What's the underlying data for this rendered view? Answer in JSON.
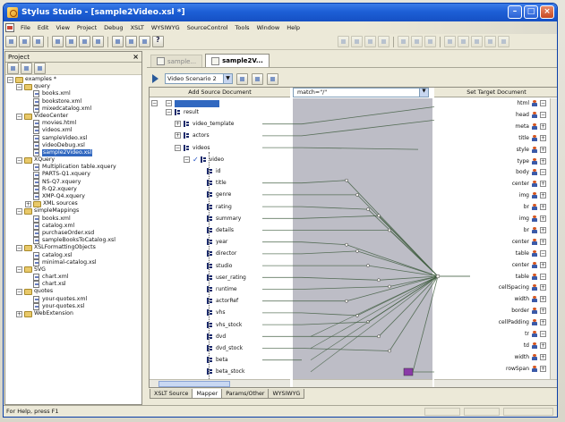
{
  "window": {
    "title": "Stylus Studio - [sample2Video.xsl *]"
  },
  "menu": {
    "items": [
      "File",
      "Edit",
      "View",
      "Project",
      "Debug",
      "XSLT",
      "WYSIWYG",
      "SourceControl",
      "Tools",
      "Window",
      "Help"
    ]
  },
  "project_panel": {
    "title": "Project",
    "tree": [
      {
        "label": "examples *",
        "kind": "folder",
        "depth": 0,
        "exp": "−"
      },
      {
        "label": "query",
        "kind": "folder",
        "depth": 1,
        "exp": "−"
      },
      {
        "label": "books.xml",
        "kind": "file",
        "depth": 2
      },
      {
        "label": "bookstore.xml",
        "kind": "file",
        "depth": 2
      },
      {
        "label": "mixedcatalog.xml",
        "kind": "file",
        "depth": 2
      },
      {
        "label": "VideoCenter",
        "kind": "folder",
        "depth": 1,
        "exp": "−"
      },
      {
        "label": "movies.html",
        "kind": "file",
        "depth": 2
      },
      {
        "label": "videos.xml",
        "kind": "file",
        "depth": 2
      },
      {
        "label": "sampleVideo.xsl",
        "kind": "file",
        "depth": 2
      },
      {
        "label": "videoDebug.xsl",
        "kind": "file",
        "depth": 2
      },
      {
        "label": "sample2Video.xsl",
        "kind": "file",
        "depth": 2,
        "selected": true
      },
      {
        "label": "XQuery",
        "kind": "folder",
        "depth": 1,
        "exp": "−"
      },
      {
        "label": "Multiplication table.xquery",
        "kind": "file",
        "depth": 2
      },
      {
        "label": "PARTS-Q1.xquery",
        "kind": "file",
        "depth": 2
      },
      {
        "label": "NS-Q7.xquery",
        "kind": "file",
        "depth": 2
      },
      {
        "label": "R-Q2.xquery",
        "kind": "file",
        "depth": 2
      },
      {
        "label": "XMP-Q4.xquery",
        "kind": "file",
        "depth": 2
      },
      {
        "label": "XML sources",
        "kind": "folder",
        "depth": 2,
        "exp": "+"
      },
      {
        "label": "simpleMappings",
        "kind": "folder",
        "depth": 1,
        "exp": "−"
      },
      {
        "label": "books.xml",
        "kind": "file",
        "depth": 2
      },
      {
        "label": "catalog.xml",
        "kind": "file",
        "depth": 2
      },
      {
        "label": "purchaseOrder.xsd",
        "kind": "file",
        "depth": 2
      },
      {
        "label": "sampleBooksToCatalog.xsl",
        "kind": "file",
        "depth": 2
      },
      {
        "label": "XSLFormattingObjects",
        "kind": "folder",
        "depth": 1,
        "exp": "−"
      },
      {
        "label": "catalog.xsl",
        "kind": "file",
        "depth": 2
      },
      {
        "label": "minimal-catalog.xsl",
        "kind": "file",
        "depth": 2
      },
      {
        "label": "SVG",
        "kind": "folder",
        "depth": 1,
        "exp": "−"
      },
      {
        "label": "chart.xml",
        "kind": "file",
        "depth": 2
      },
      {
        "label": "chart.xsl",
        "kind": "file",
        "depth": 2
      },
      {
        "label": "quotes",
        "kind": "folder",
        "depth": 1,
        "exp": "−"
      },
      {
        "label": "your-quotes.xml",
        "kind": "file",
        "depth": 2
      },
      {
        "label": "your-quotes.xsl",
        "kind": "file",
        "depth": 2
      },
      {
        "label": "WebExtension",
        "kind": "folder",
        "depth": 1,
        "exp": "+"
      }
    ]
  },
  "doc_tabs": {
    "inactive_label": "sample...",
    "active_label": "sample2V..."
  },
  "scenario": {
    "selected": "Video Scenario 2"
  },
  "mapper": {
    "source_header": "Add Source Document",
    "match_value": "match=\"/\"",
    "target_header": "Set Target Document",
    "source_nodes": [
      {
        "label": "result",
        "indent": 1,
        "exp": "−"
      },
      {
        "label": "video_template",
        "indent": 2,
        "exp": "+"
      },
      {
        "label": "actors",
        "indent": 2,
        "exp": "+"
      },
      {
        "label": "videos",
        "indent": 2,
        "exp": "−"
      },
      {
        "label": "video",
        "indent": 3,
        "exp": "−",
        "check": "✓"
      },
      {
        "label": "id",
        "indent": 4
      },
      {
        "label": "title",
        "indent": 4
      },
      {
        "label": "genre",
        "indent": 4
      },
      {
        "label": "rating",
        "indent": 4
      },
      {
        "label": "summary",
        "indent": 4
      },
      {
        "label": "details",
        "indent": 4
      },
      {
        "label": "year",
        "indent": 4
      },
      {
        "label": "director",
        "indent": 4
      },
      {
        "label": "studio",
        "indent": 4
      },
      {
        "label": "user_rating",
        "indent": 4
      },
      {
        "label": "runtime",
        "indent": 4
      },
      {
        "label": "actorRef",
        "indent": 4
      },
      {
        "label": "vhs",
        "indent": 4
      },
      {
        "label": "vhs_stock",
        "indent": 4
      },
      {
        "label": "dvd",
        "indent": 4
      },
      {
        "label": "dvd_stock",
        "indent": 4
      },
      {
        "label": "beta",
        "indent": 4
      },
      {
        "label": "beta_stock",
        "indent": 4
      }
    ],
    "target_nodes": [
      {
        "label": "html",
        "exp": "−"
      },
      {
        "label": "head",
        "exp": "−"
      },
      {
        "label": "meta",
        "exp": "+"
      },
      {
        "label": "title",
        "exp": "+"
      },
      {
        "label": "style",
        "exp": "+"
      },
      {
        "label": "type",
        "exp": "+"
      },
      {
        "label": "body",
        "exp": "−"
      },
      {
        "label": "center",
        "exp": "+"
      },
      {
        "label": "img",
        "exp": "+"
      },
      {
        "label": "br",
        "exp": "+"
      },
      {
        "label": "img",
        "exp": "+"
      },
      {
        "label": "br",
        "exp": "+"
      },
      {
        "label": "center",
        "exp": "+"
      },
      {
        "label": "table",
        "exp": "−"
      },
      {
        "label": "center",
        "exp": "+"
      },
      {
        "label": "table",
        "exp": "−"
      },
      {
        "label": "cellSpacing",
        "exp": "+"
      },
      {
        "label": "width",
        "exp": "+"
      },
      {
        "label": "border",
        "exp": "+"
      },
      {
        "label": "cellPadding",
        "exp": "+"
      },
      {
        "label": "tr",
        "exp": "−"
      },
      {
        "label": "td",
        "exp": "+"
      },
      {
        "label": "width",
        "exp": "+"
      },
      {
        "label": "rowSpan",
        "exp": "+"
      }
    ]
  },
  "bottom_tabs": [
    "XSLT Source",
    "Mapper",
    "Params/Other",
    "WYSIWYG"
  ],
  "status": {
    "text": "For Help, press F1"
  },
  "colors": {
    "title_bar": "#1d5fd6",
    "selection": "#3168c0",
    "canvas": "#bdbdc6",
    "link_lines": "#3c5a3c",
    "junction_node": "#8a3aa8"
  }
}
